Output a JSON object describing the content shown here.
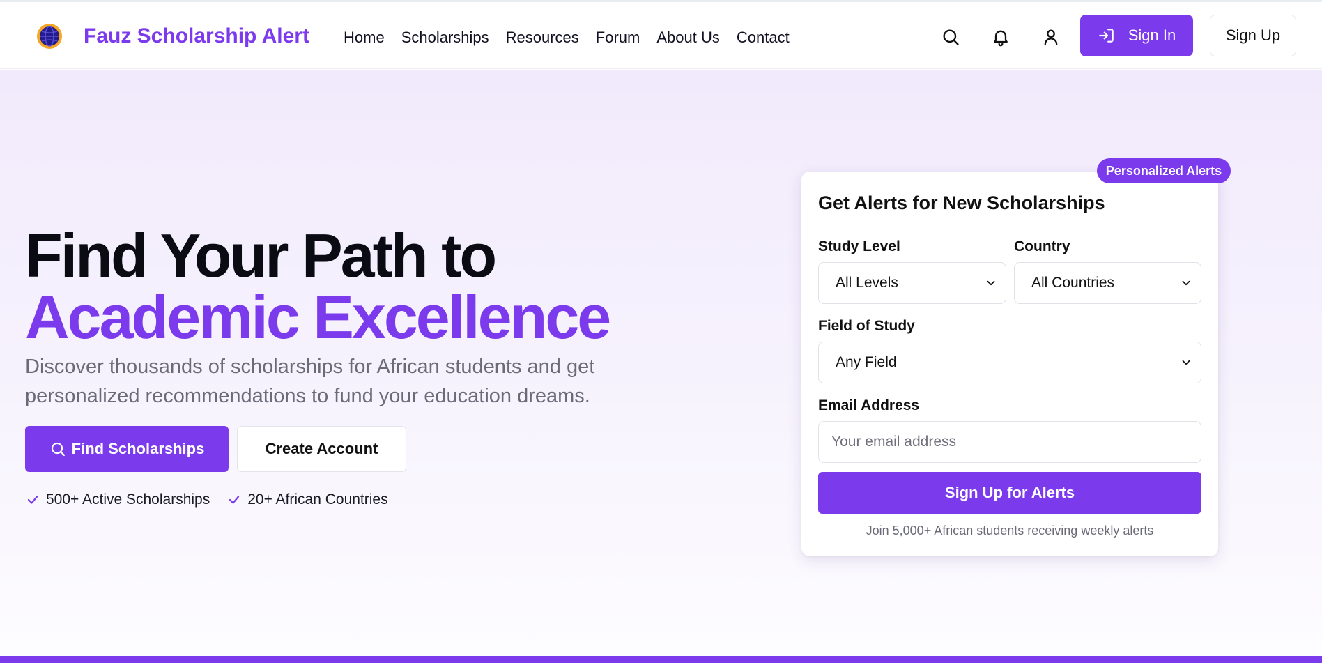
{
  "brand": {
    "name": "Fauz Scholarship Alert",
    "logo_icon": "globe-logo-icon",
    "accent_color": "#7c3aed"
  },
  "nav": {
    "items": [
      "Home",
      "Scholarships",
      "Resources",
      "Forum",
      "About Us",
      "Contact"
    ]
  },
  "header_actions": {
    "search_icon": "search-icon",
    "notifications_icon": "bell-icon",
    "profile_icon": "user-icon",
    "sign_in_label": "Sign In",
    "sign_in_icon": "sign-in-arrow-icon",
    "sign_up_label": "Sign Up"
  },
  "hero": {
    "headline_line1": "Find Your Path to",
    "headline_line2": "Academic Excellence",
    "lead": "Discover thousands of scholarships for African students and get personalized recommendations to fund your education dreams.",
    "find_label": "Find Scholarships",
    "create_label": "Create Account",
    "stats": [
      "500+ Active Scholarships",
      "20+ African Countries"
    ]
  },
  "alert_form": {
    "badge": "Personalized Alerts",
    "title": "Get Alerts for New Scholarships",
    "study_level_label": "Study Level",
    "study_level_value": "All Levels",
    "country_label": "Country",
    "country_value": "All Countries",
    "field_label": "Field of Study",
    "field_value": "Any Field",
    "email_label": "Email Address",
    "email_placeholder": "Your email address",
    "submit_label": "Sign Up for Alerts",
    "footnote": "Join 5,000+ African students receiving weekly alerts"
  }
}
